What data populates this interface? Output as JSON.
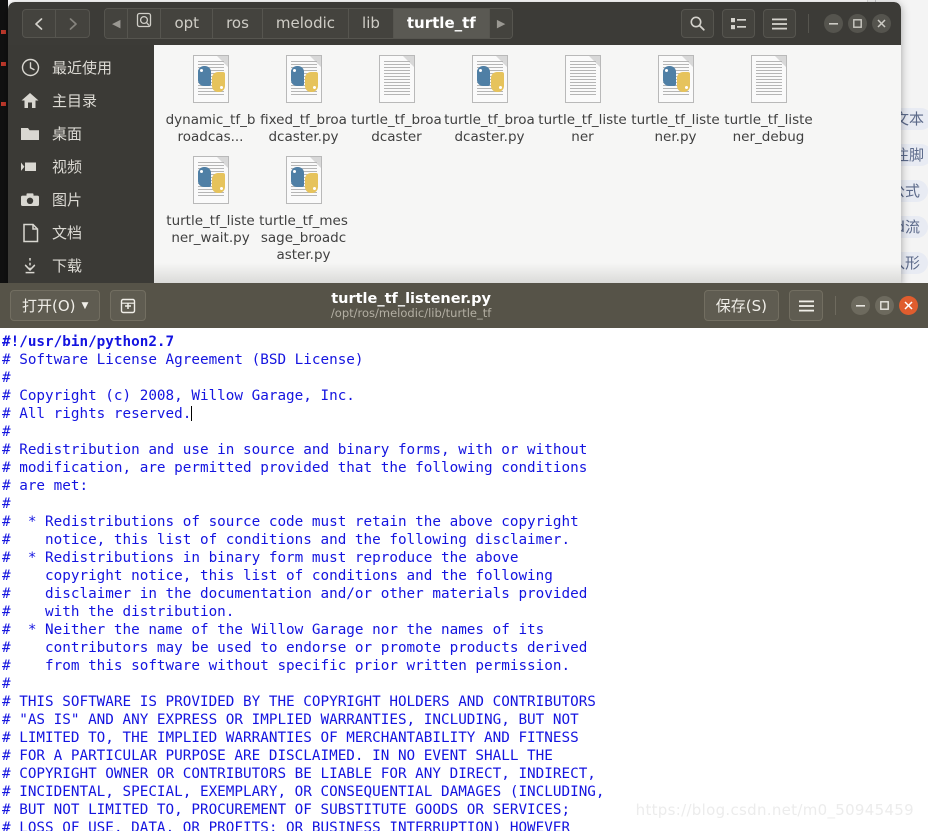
{
  "background_window": {
    "tags": [
      "文本",
      "注脚",
      "公式",
      "mermaid流",
      "手入形"
    ]
  },
  "file_manager": {
    "nav": {
      "back_icon": "chevron-left-icon",
      "forward_icon": "chevron-right-icon"
    },
    "breadcrumb": {
      "prev_arrow": "◀",
      "next_arrow": "▶",
      "root_icon": "drive-icon",
      "items": [
        "opt",
        "ros",
        "melodic",
        "lib",
        "turtle_tf"
      ],
      "current": "turtle_tf"
    },
    "actions": {
      "search_icon": "search-icon",
      "view_toggle_icon": "list-view-icon",
      "menu_icon": "hamburger-menu-icon",
      "minimize": "—",
      "maximize": "▣",
      "close": "✕"
    },
    "sidebar": {
      "items": [
        {
          "label": "最近使用",
          "icon": "clock-icon"
        },
        {
          "label": "主目录",
          "icon": "home-icon"
        },
        {
          "label": "桌面",
          "icon": "folder-icon"
        },
        {
          "label": "视频",
          "icon": "video-icon"
        },
        {
          "label": "图片",
          "icon": "camera-icon"
        },
        {
          "label": "文档",
          "icon": "document-icon"
        },
        {
          "label": "下载",
          "icon": "download-icon"
        }
      ]
    },
    "files": [
      {
        "name": "dynamic_tf_broadcas...",
        "type": "python"
      },
      {
        "name": "fixed_tf_broadcaster.py",
        "type": "python"
      },
      {
        "name": "turtle_tf_broadcaster",
        "type": "text"
      },
      {
        "name": "turtle_tf_broadcaster.py",
        "type": "python"
      },
      {
        "name": "turtle_tf_listener",
        "type": "text"
      },
      {
        "name": "turtle_tf_listener.py",
        "type": "python"
      },
      {
        "name": "turtle_tf_listener_debug",
        "type": "text"
      },
      {
        "name": "turtle_tf_listener_wait.py",
        "type": "python"
      },
      {
        "name": "turtle_tf_message_broadcaster.py",
        "type": "python"
      }
    ]
  },
  "editor": {
    "open_label": "打开(O)",
    "open_caret": "▼",
    "new_tab_icon": "new-document-icon",
    "title": "turtle_tf_listener.py",
    "subtitle": "/opt/ros/melodic/lib/turtle_tf",
    "save_label": "保存(S)",
    "menu_icon": "hamburger-menu-icon",
    "minimize": "—",
    "maximize": "▣",
    "close": "✕",
    "code_lines": [
      "#!/usr/bin/python2.7",
      "# Software License Agreement (BSD License)",
      "#",
      "# Copyright (c) 2008, Willow Garage, Inc.",
      "# All rights reserved.",
      "#",
      "# Redistribution and use in source and binary forms, with or without",
      "# modification, are permitted provided that the following conditions",
      "# are met:",
      "#",
      "#  * Redistributions of source code must retain the above copyright",
      "#    notice, this list of conditions and the following disclaimer.",
      "#  * Redistributions in binary form must reproduce the above",
      "#    copyright notice, this list of conditions and the following",
      "#    disclaimer in the documentation and/or other materials provided",
      "#    with the distribution.",
      "#  * Neither the name of the Willow Garage nor the names of its",
      "#    contributors may be used to endorse or promote products derived",
      "#    from this software without specific prior written permission.",
      "#",
      "# THIS SOFTWARE IS PROVIDED BY THE COPYRIGHT HOLDERS AND CONTRIBUTORS",
      "# \"AS IS\" AND ANY EXPRESS OR IMPLIED WARRANTIES, INCLUDING, BUT NOT",
      "# LIMITED TO, THE IMPLIED WARRANTIES OF MERCHANTABILITY AND FITNESS",
      "# FOR A PARTICULAR PURPOSE ARE DISCLAIMED. IN NO EVENT SHALL THE",
      "# COPYRIGHT OWNER OR CONTRIBUTORS BE LIABLE FOR ANY DIRECT, INDIRECT,",
      "# INCIDENTAL, SPECIAL, EXEMPLARY, OR CONSEQUENTIAL DAMAGES (INCLUDING,",
      "# BUT NOT LIMITED TO, PROCUREMENT OF SUBSTITUTE GOODS OR SERVICES;",
      "# LOSS OF USE, DATA, OR PROFITS; OR BUSINESS INTERRUPTION) HOWEVER"
    ],
    "caret_line_index": 4
  },
  "watermark": "https://blog.csdn.net/m0_50945459",
  "colors": {
    "fm_header": "#3c3b37",
    "fm_sidebar": "#3b3a36",
    "editor_header": "#565348",
    "code_blue": "#1414e0",
    "close_orange": "#e05d2e"
  }
}
